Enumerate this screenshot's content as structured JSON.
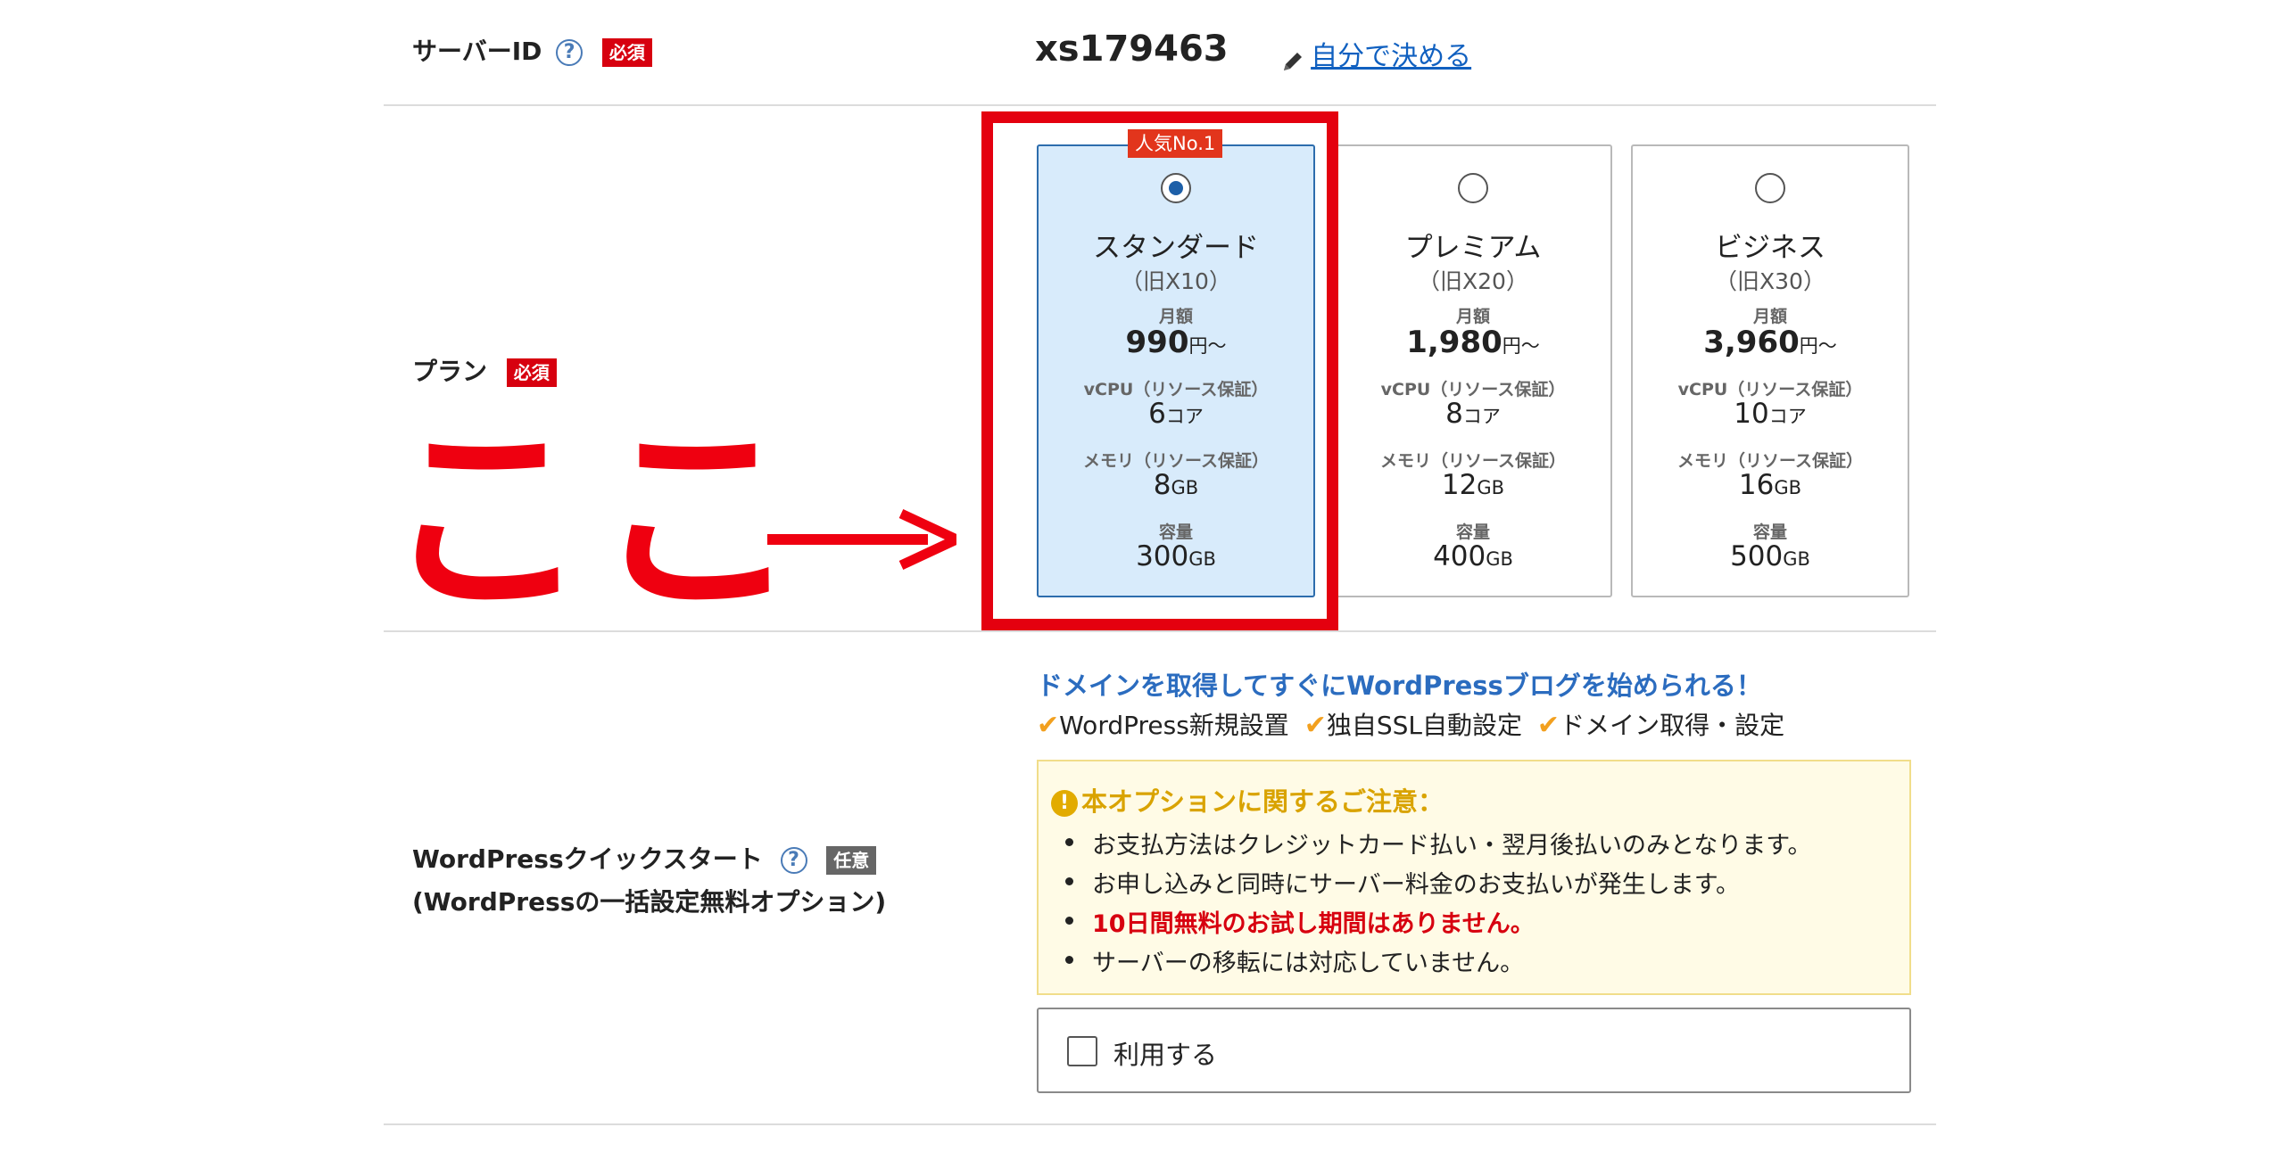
{
  "server_id": {
    "label": "サーバーID",
    "help": "?",
    "required": "必須",
    "value": "xs179463",
    "edit_link": "自分で決める"
  },
  "plan": {
    "label": "プラン",
    "required": "必須",
    "badge": "人気No.1",
    "selected": 0,
    "cards": [
      {
        "name": "スタンダード",
        "old": "（旧X10）",
        "price_label": "月額",
        "price": "990",
        "price_unit": "円〜",
        "cpu_label": "vCPU（リソース保証）",
        "cpu": "6",
        "cpu_unit": "コア",
        "mem_label": "メモリ（リソース保証）",
        "mem": "8",
        "mem_unit": "GB",
        "disk_label": "容量",
        "disk": "300",
        "disk_unit": "GB"
      },
      {
        "name": "プレミアム",
        "old": "（旧X20）",
        "price_label": "月額",
        "price": "1,980",
        "price_unit": "円〜",
        "cpu_label": "vCPU（リソース保証）",
        "cpu": "8",
        "cpu_unit": "コア",
        "mem_label": "メモリ（リソース保証）",
        "mem": "12",
        "mem_unit": "GB",
        "disk_label": "容量",
        "disk": "400",
        "disk_unit": "GB"
      },
      {
        "name": "ビジネス",
        "old": "（旧X30）",
        "price_label": "月額",
        "price": "3,960",
        "price_unit": "円〜",
        "cpu_label": "vCPU（リソース保証）",
        "cpu": "10",
        "cpu_unit": "コア",
        "mem_label": "メモリ（リソース保証）",
        "mem": "16",
        "mem_unit": "GB",
        "disk_label": "容量",
        "disk": "500",
        "disk_unit": "GB"
      }
    ]
  },
  "annotation": {
    "text": "ここ"
  },
  "wp_quick": {
    "label": "WordPressクイックスタート",
    "help": "?",
    "optional": "任意",
    "sublabel": "(WordPressの一括設定無料オプション)",
    "tagline": "ドメインを取得してすぐにWordPressブログを始められる！",
    "checks": [
      "WordPress新規設置",
      "独自SSL自動設定",
      "ドメイン取得・設定"
    ],
    "check_mark": "✔",
    "notice_icon": "!",
    "notice_title": "本オプションに関するご注意：",
    "notice_items": [
      "お支払方法はクレジットカード払い・翌月後払いのみとなります。",
      "お申し込みと同時にサーバー料金のお支払いが発生します。",
      "10日間無料のお試し期間はありません。",
      "サーバーの移転には対応していません。"
    ],
    "use_label": "利用する"
  },
  "colors": {
    "accent": "#1d5fa8",
    "required": "#d7000f",
    "annotation": "#ef0010",
    "check": "#f2a01f"
  }
}
